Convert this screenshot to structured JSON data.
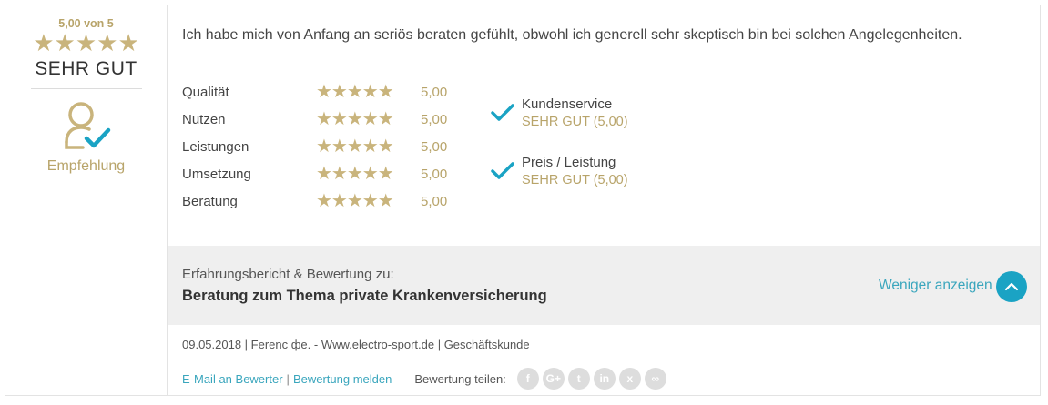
{
  "summary": {
    "score_text": "5,00 von 5",
    "stars": "★★★★★",
    "verdict": "SEHR GUT",
    "recommendation_label": "Empfehlung",
    "rating_value": 5.0,
    "rating_max": 5
  },
  "review": {
    "text": "Ich habe mich von Anfang an seriös beraten gefühlt, obwohl ich generell sehr skeptisch bin bei solchen Angelegenheiten."
  },
  "ratings": [
    {
      "label": "Qualität",
      "stars": "★★★★★",
      "value": "5,00"
    },
    {
      "label": "Nutzen",
      "stars": "★★★★★",
      "value": "5,00"
    },
    {
      "label": "Leistungen",
      "stars": "★★★★★",
      "value": "5,00"
    },
    {
      "label": "Umsetzung",
      "stars": "★★★★★",
      "value": "5,00"
    },
    {
      "label": "Beratung",
      "stars": "★★★★★",
      "value": "5,00"
    }
  ],
  "checks": [
    {
      "title": "Kundenservice",
      "subtitle": "SEHR GUT (5,00)"
    },
    {
      "title": "Preis / Leistung",
      "subtitle": "SEHR GUT (5,00)"
    }
  ],
  "topic": {
    "pre_label": "Erfahrungsbericht & Bewertung zu:",
    "title": "Beratung zum Thema private Krankenversicherung",
    "less_label": "Weniger anzeigen"
  },
  "meta": {
    "line": "09.05.2018 | Ferenc фе. - Www.electro-sport.de | Geschäftskunde"
  },
  "links": {
    "email": "E-Mail an Bewerter",
    "separator": "|",
    "report": "Bewertung melden",
    "share_label": "Bewertung teilen:"
  },
  "share_icons": [
    {
      "name": "facebook-icon",
      "glyph": "f"
    },
    {
      "name": "google-plus-icon",
      "glyph": "G+"
    },
    {
      "name": "twitter-icon",
      "glyph": "t"
    },
    {
      "name": "linkedin-icon",
      "glyph": "in"
    },
    {
      "name": "xing-icon",
      "glyph": "x"
    },
    {
      "name": "link-icon",
      "glyph": "∞"
    }
  ],
  "colors": {
    "gold": "#c9b47c",
    "accent": "#1aa3c4",
    "link": "#3aa6bd"
  }
}
